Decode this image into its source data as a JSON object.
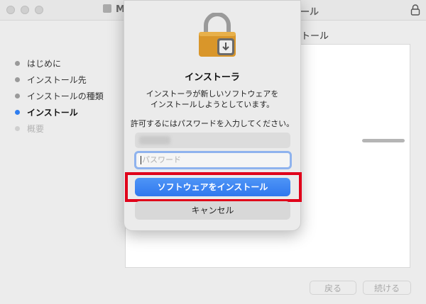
{
  "window": {
    "title_left": "M",
    "title_right": "ール"
  },
  "sidebar": {
    "steps": [
      {
        "label": "はじめに",
        "state": "done"
      },
      {
        "label": "インストール先",
        "state": "done"
      },
      {
        "label": "インストールの種類",
        "state": "done"
      },
      {
        "label": "インストール",
        "state": "active"
      },
      {
        "label": "概要",
        "state": "disabled"
      }
    ]
  },
  "background": {
    "heading": "トール",
    "install_progress": 0.15,
    "back_label": "戻る",
    "continue_label": "続ける"
  },
  "dialog": {
    "title": "インストーラ",
    "message_line1": "インストーラが新しいソフトウェアを",
    "message_line2": "インストールしようとしています。",
    "prompt": "許可するにはパスワードを入力してください。",
    "password_placeholder": "パスワード",
    "install_label": "ソフトウェアをインストール",
    "cancel_label": "キャンセル"
  },
  "colors": {
    "accent": "#2f7ef0",
    "highlight": "#e0001a",
    "lock_gold": "#d9962a"
  }
}
